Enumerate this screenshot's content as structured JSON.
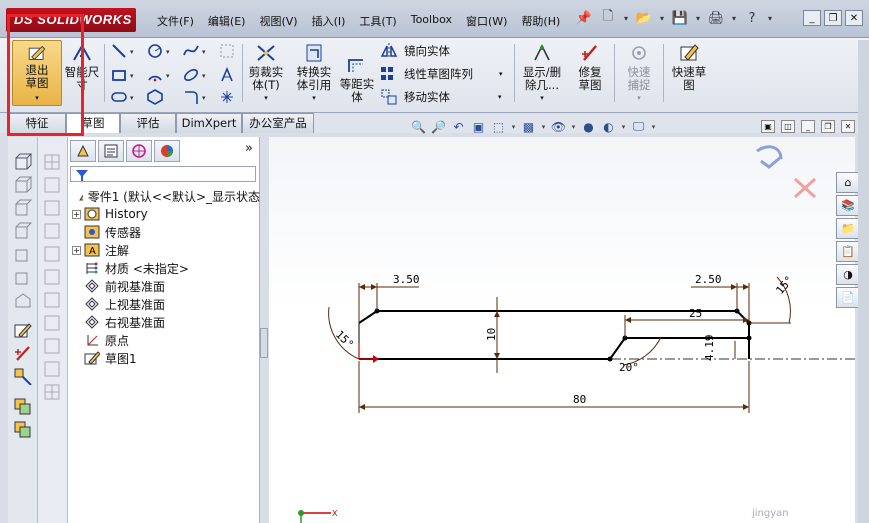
{
  "app": {
    "brand": "SOLIDWORKS",
    "brand_prefix": "DS"
  },
  "menu": [
    "文件(F)",
    "编辑(E)",
    "视图(V)",
    "插入(I)",
    "工具(T)",
    "Toolbox",
    "窗口(W)",
    "帮助(H)"
  ],
  "commands": {
    "exit_sketch": "退出草图",
    "smart_dim": "智能尺寸",
    "trim": "剪裁实体(T)",
    "convert": "转换实体引用",
    "offset": "等距实体",
    "mirror": "镜向实体",
    "linear_pattern": "线性草图阵列",
    "move": "移动实体",
    "show_delete": "显示/删除几...",
    "repair": "修复草图",
    "quick_snap": "快速捕捉",
    "rapid_sketch": "快速草图"
  },
  "tabs": [
    "特征",
    "草图",
    "评估",
    "DimXpert",
    "办公室产品"
  ],
  "active_tab": "草图",
  "tree": {
    "root": "零件1 (默认<<默认>_显示状态",
    "items": [
      "History",
      "传感器",
      "注解",
      "材质 <未指定>",
      "前视基准面",
      "上视基准面",
      "右视基准面",
      "原点",
      "草图1"
    ]
  },
  "drawing": {
    "dims": {
      "top_left": "3.50",
      "top_right": "2.50",
      "angle_left": "15°",
      "angle_right": "15°",
      "height": "10",
      "inner_len": "25",
      "inner_h": "4.19",
      "angle_bottom": "20°",
      "total": "80"
    }
  },
  "colors": {
    "highlight": "#e8242a",
    "dim_line": "#5a2a0a",
    "sketch": "#000000",
    "origin": "#d00000"
  },
  "watermark": "jingyan"
}
